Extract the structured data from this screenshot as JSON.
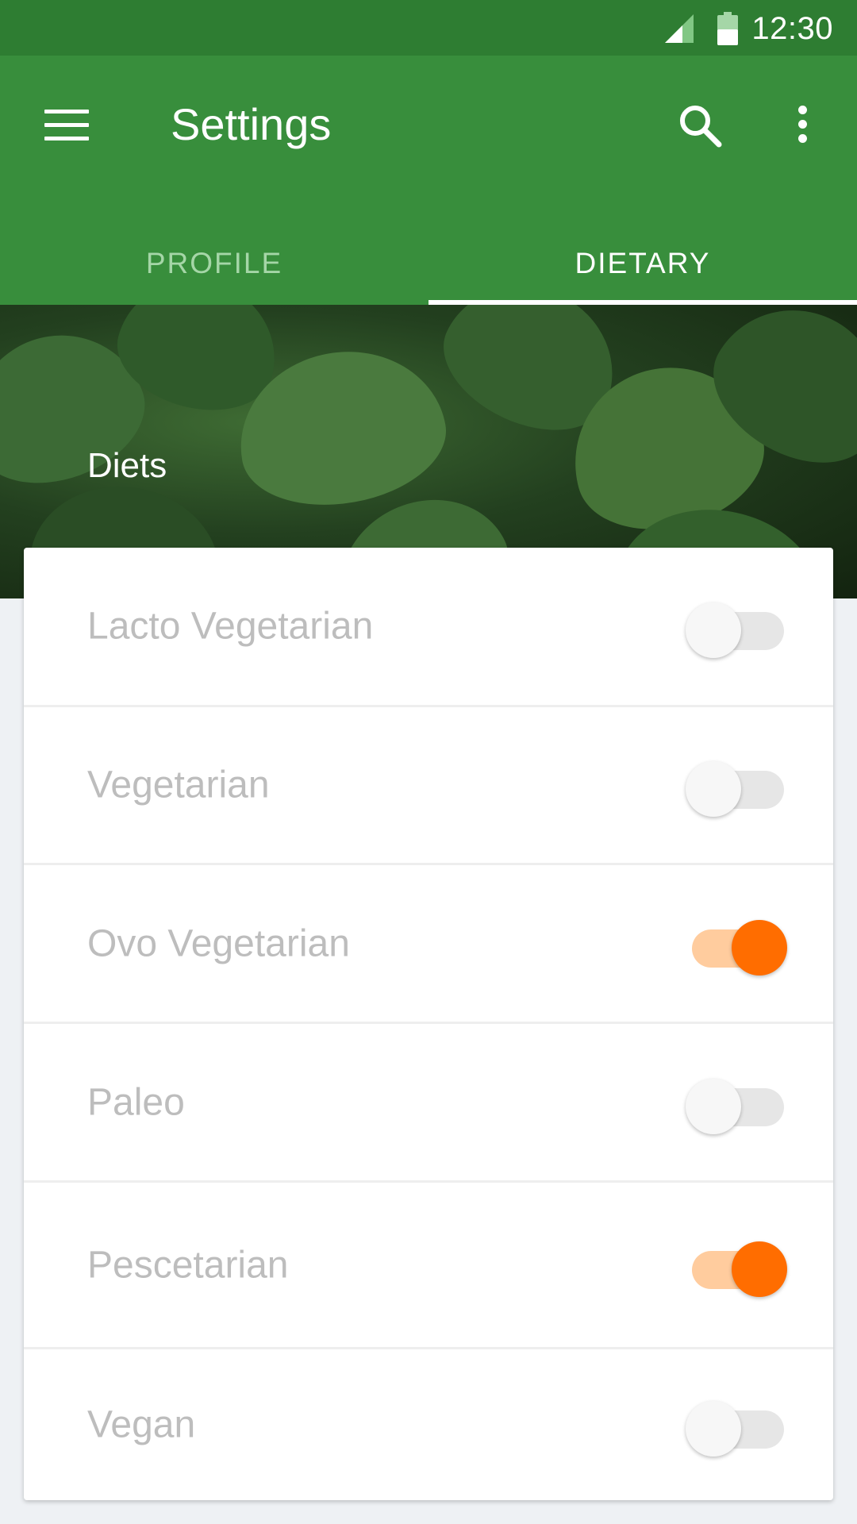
{
  "status_bar": {
    "time": "12:30"
  },
  "app_bar": {
    "title": "Settings"
  },
  "tabs": [
    {
      "label": "PROFILE",
      "active": false
    },
    {
      "label": "DIETARY",
      "active": true
    }
  ],
  "hero": {
    "section_title": "Diets"
  },
  "diets": [
    {
      "label": "Lacto Vegetarian",
      "enabled": false
    },
    {
      "label": "Vegetarian",
      "enabled": false
    },
    {
      "label": "Ovo Vegetarian",
      "enabled": true
    },
    {
      "label": "Paleo",
      "enabled": false
    },
    {
      "label": "Pescetarian",
      "enabled": true
    },
    {
      "label": "Vegan",
      "enabled": false
    }
  ],
  "colors": {
    "status_bar": "#2E7D32",
    "primary": "#388E3C",
    "accent": "#FF6D00",
    "accent_track": "#FFCC9E"
  },
  "icons": {
    "menu": "hamburger-menu-icon",
    "search": "search-icon",
    "more": "more-vertical-icon",
    "signal": "cell-signal-icon",
    "battery": "battery-icon"
  }
}
